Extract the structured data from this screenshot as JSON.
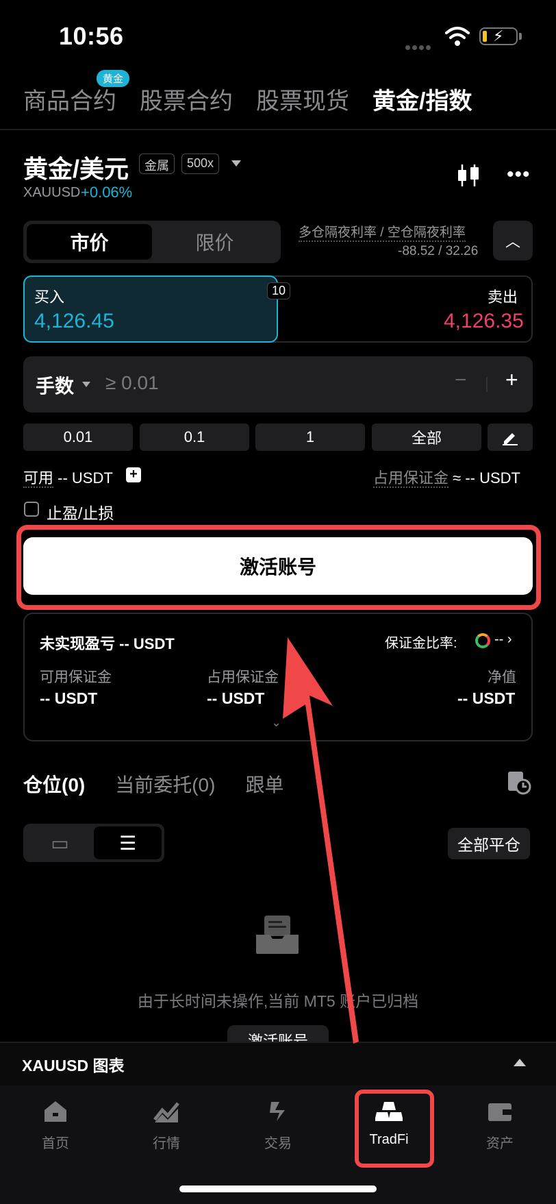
{
  "status": {
    "time": "10:56"
  },
  "top_tabs": [
    {
      "label": "商品合约",
      "badge": "黄金"
    },
    {
      "label": "股票合约"
    },
    {
      "label": "股票现货"
    },
    {
      "label": "黄金/指数",
      "active": true
    }
  ],
  "symbol": {
    "title": "黄金/美元",
    "tag": "金属",
    "leverage": "500x",
    "code": "XAUUSD",
    "change": "+0.06%"
  },
  "order_type": {
    "market": "市价",
    "limit": "限价",
    "selected": "市价"
  },
  "overnight": {
    "label": "多仓隔夜利率 / 空仓隔夜利率",
    "value": "-88.52 / 32.26"
  },
  "trade": {
    "buy_label": "买入",
    "buy_price": "4,126.45",
    "spread": "10",
    "sell_label": "卖出",
    "sell_price": "4,126.35"
  },
  "quantity": {
    "label": "手数",
    "placeholder": "≥ 0.01",
    "minus": "−",
    "plus": "+"
  },
  "presets": [
    "0.01",
    "0.1",
    "1",
    "全部"
  ],
  "available": {
    "label": "可用",
    "value": "-- USDT"
  },
  "margin_used": {
    "label": "占用保证金",
    "value": "≈ -- USDT"
  },
  "tpsl": {
    "label": "止盈/止损",
    "checked": false
  },
  "activate_label": "激活账号",
  "account": {
    "upnl": "未实现盈亏 -- USDT",
    "margin_ratio_label": "保证金比率:",
    "margin_ratio_value": "--",
    "cols": [
      {
        "label": "可用保证金",
        "value": "-- USDT"
      },
      {
        "label": "占用保证金",
        "value": "-- USDT"
      },
      {
        "label": "净值",
        "value": "-- USDT"
      }
    ]
  },
  "position_tabs": [
    {
      "label": "仓位(0)",
      "active": true
    },
    {
      "label": "当前委托(0)"
    },
    {
      "label": "跟单"
    }
  ],
  "close_all": "全部平仓",
  "empty_text": "由于长时间未操作,当前 MT5 账户已归档",
  "empty_button": "激活账号",
  "chart_bar": {
    "label": "XAUUSD 图表"
  },
  "nav": [
    {
      "label": "首页",
      "icon": "home-icon"
    },
    {
      "label": "行情",
      "icon": "market-icon"
    },
    {
      "label": "交易",
      "icon": "trade-icon"
    },
    {
      "label": "TradFi",
      "icon": "gold-bars-icon",
      "active": true
    },
    {
      "label": "资产",
      "icon": "wallet-icon"
    }
  ],
  "colors": {
    "accent": "#1fb4d6",
    "sell": "#f0406a",
    "highlight": "#f04848"
  }
}
